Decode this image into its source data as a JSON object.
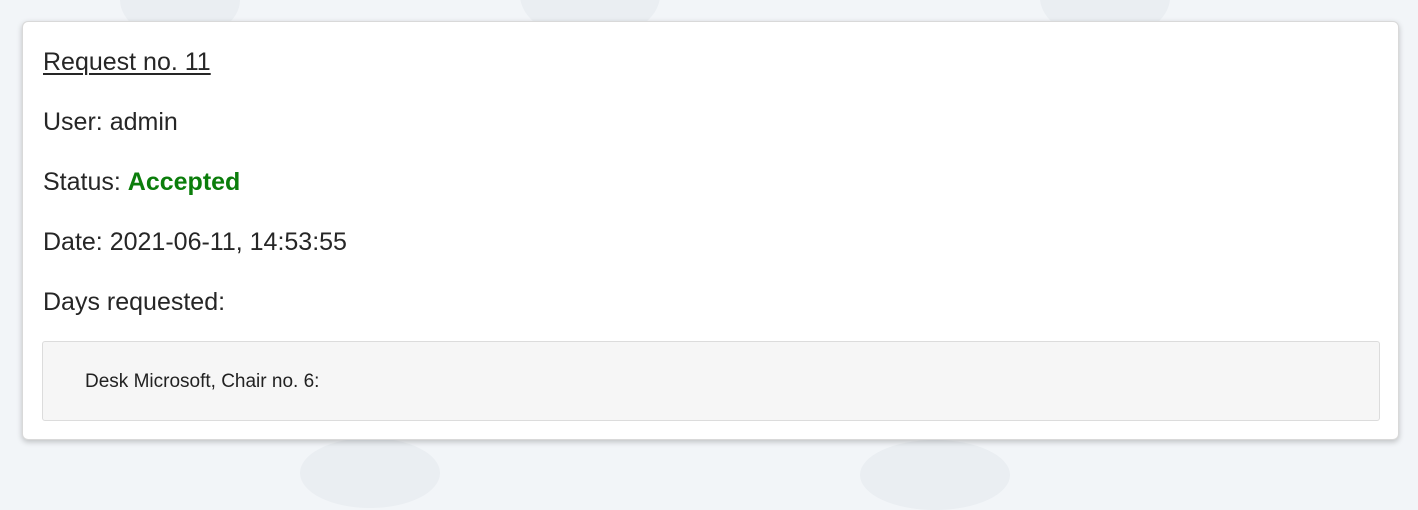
{
  "request": {
    "title": "Request no. 11",
    "user_label": "User:",
    "user_value": "admin",
    "status_label": "Status:",
    "status_value": "Accepted",
    "date_label": "Date:",
    "date_value": "2021-06-11, 14:53:55",
    "days_label": "Days requested:",
    "days": [
      {
        "text": "Desk Microsoft, Chair no. 6:"
      }
    ]
  },
  "colors": {
    "status_accepted": "#0b7d0b",
    "background": "#f2f5f8",
    "card": "#ffffff",
    "days_box": "#f6f6f6"
  }
}
